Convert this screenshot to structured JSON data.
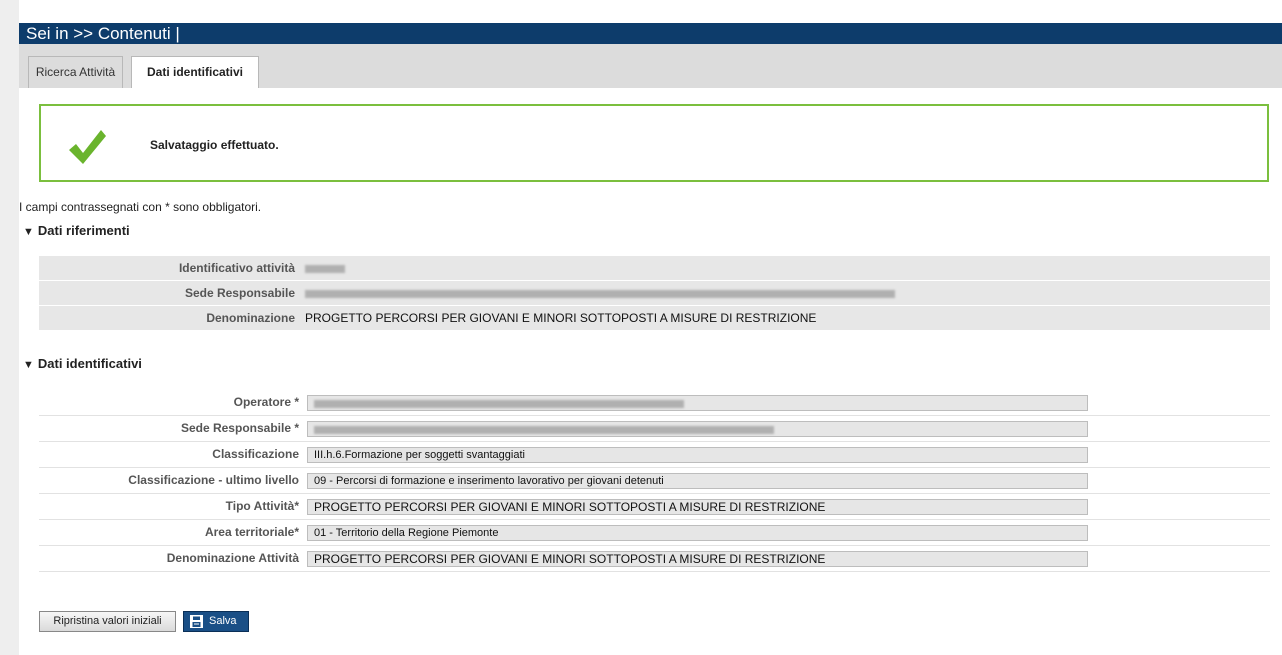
{
  "breadcrumb": "Sei in >> Contenuti |",
  "tabs": [
    {
      "label": "Ricerca Attività",
      "active": false
    },
    {
      "label": "Dati identificativi",
      "active": true
    }
  ],
  "success": {
    "message": "Salvataggio effettuato.",
    "icon": "checkmark-icon",
    "color": "#6ab42d"
  },
  "required_note": "I campi contrassegnati con * sono obbligatori.",
  "sections": {
    "riferimenti": {
      "title": "Dati riferimenti",
      "rows": [
        {
          "label": "Identificativo attività",
          "value": ""
        },
        {
          "label": "Sede Responsabile",
          "value": ""
        },
        {
          "label": "Denominazione",
          "value": "PROGETTO PERCORSI PER GIOVANI E MINORI SOTTOPOSTI A MISURE DI RESTRIZIONE"
        }
      ]
    },
    "identificativi": {
      "title": "Dati identificativi",
      "rows": [
        {
          "label": "Operatore *",
          "value": ""
        },
        {
          "label": "Sede Responsabile *",
          "value": ""
        },
        {
          "label": "Classificazione",
          "value": "III.h.6.Formazione per soggetti svantaggiati"
        },
        {
          "label": "Classificazione - ultimo livello",
          "value": "09 - Percorsi di formazione e inserimento lavorativo per giovani detenuti"
        },
        {
          "label": "Tipo Attività*",
          "value": "PROGETTO PERCORSI PER GIOVANI E MINORI SOTTOPOSTI A MISURE DI RESTRIZIONE"
        },
        {
          "label": "Area territoriale*",
          "value": "01 - Territorio della Regione Piemonte"
        },
        {
          "label": "Denominazione Attività",
          "value": "PROGETTO PERCORSI PER GIOVANI E MINORI SOTTOPOSTI A MISURE DI RESTRIZIONE"
        }
      ]
    }
  },
  "buttons": {
    "reset_label": "Ripristina valori iniziali",
    "save_label": "Salva",
    "save_icon": "floppy-disk-icon"
  },
  "colors": {
    "header_bg": "#0d3c6b",
    "success_border": "#7bbf3e",
    "save_button": "#1a4f86"
  }
}
